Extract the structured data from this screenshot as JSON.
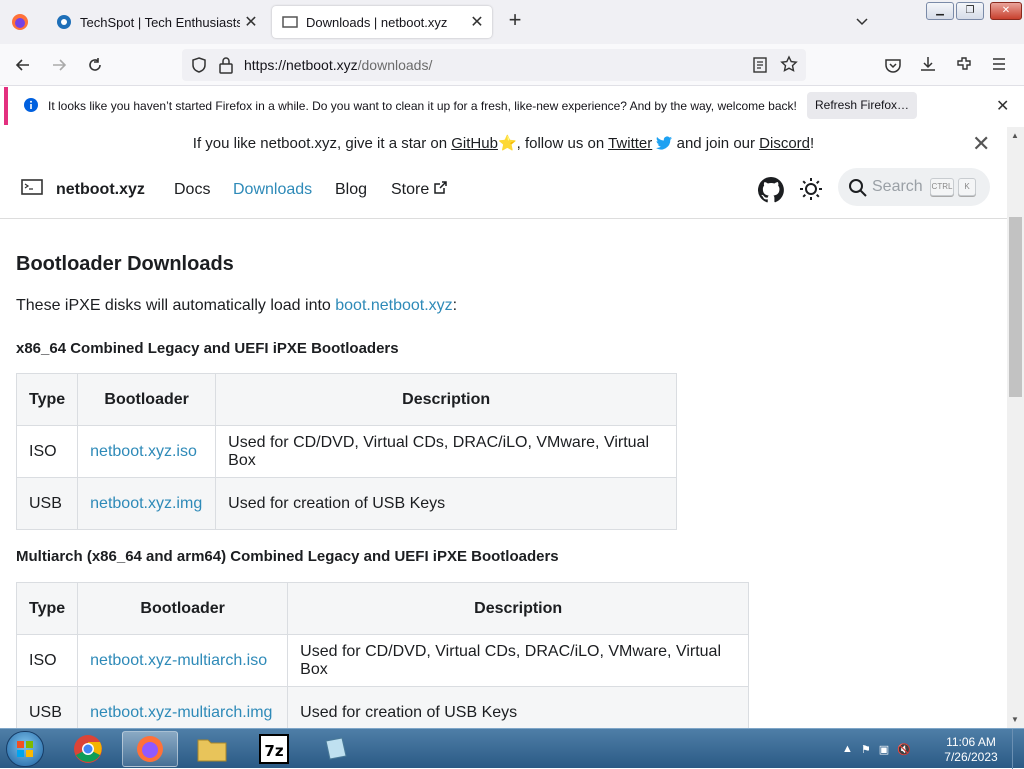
{
  "browser": {
    "tabs": [
      {
        "title": "TechSpot | Tech Enthusiasts, Po",
        "active": false
      },
      {
        "title": "Downloads | netboot.xyz",
        "active": true
      }
    ],
    "new_tab": "+",
    "url_host": "https://netboot.xyz",
    "url_path": "/downloads/",
    "notification": {
      "text": "It looks like you haven’t started Firefox in a while. Do you want to clean it up for a fresh, like-new experience? And by the way, welcome back!",
      "button": "Refresh Firefox…"
    }
  },
  "site": {
    "announcement": {
      "prefix": "If you like netboot.xyz, give it a star on ",
      "github": "GitHub",
      "star": "⭐",
      "mid": ", follow us on ",
      "twitter": "Twitter",
      "and": " and join our ",
      "discord": "Discord",
      "end": "!"
    },
    "brand": "netboot.xyz",
    "nav": [
      "Docs",
      "Downloads",
      "Blog",
      "Store"
    ],
    "search_placeholder": "Search",
    "kbd_ctrl": "CTRL",
    "kbd_k": "K"
  },
  "page": {
    "title": "Bootloader Downloads",
    "intro_prefix": "These iPXE disks will automatically load into ",
    "intro_link": "boot.netboot.xyz",
    "intro_suffix": ":",
    "section1": "x86_64 Combined Legacy and UEFI iPXE Bootloaders",
    "section2": "Multiarch (x86_64 and arm64) Combined Legacy and UEFI iPXE Bootloaders",
    "headers": [
      "Type",
      "Bootloader",
      "Description"
    ],
    "table1": [
      {
        "type": "ISO",
        "file": "netboot.xyz.iso",
        "desc": "Used for CD/DVD, Virtual CDs, DRAC/iLO, VMware, Virtual Box"
      },
      {
        "type": "USB",
        "file": "netboot.xyz.img",
        "desc": "Used for creation of USB Keys"
      }
    ],
    "table2": [
      {
        "type": "ISO",
        "file": "netboot.xyz-multiarch.iso",
        "desc": "Used for CD/DVD, Virtual CDs, DRAC/iLO, VMware, Virtual Box"
      },
      {
        "type": "USB",
        "file": "netboot.xyz-multiarch.img",
        "desc": "Used for creation of USB Keys"
      }
    ]
  },
  "taskbar": {
    "time": "11:06 AM",
    "date": "7/26/2023"
  },
  "colors": {
    "link": "#2e8ab8",
    "notif_accent": "#e3307f"
  }
}
